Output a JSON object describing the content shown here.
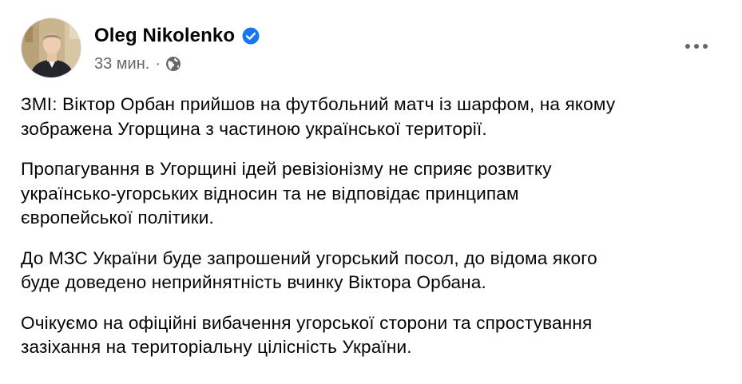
{
  "author": {
    "name": "Oleg Nikolenko",
    "verified": true,
    "timestamp": "33 мин.",
    "separator": "·",
    "audience_icon": "globe-icon"
  },
  "menu_icon": "more-options-icon",
  "colors": {
    "verified_blue": "#1877f2",
    "meta_gray": "#65676b",
    "text": "#050505"
  },
  "post": {
    "paragraphs": [
      {
        "line1": "ЗМІ: Віктор Орбан прийшов на футбольний матч із шарфом, на якому",
        "line2": "зображена Угорщина з частиною української території."
      },
      {
        "line1": "Пропагування в Угорщині ідей ревізіонізму не сприяє розвитку",
        "line2": "українсько-угорських відносин та не відповідає принципам",
        "line3": "європейської політики."
      },
      {
        "line1": "До МЗС України буде запрошений угорський посол, до відома якого",
        "line2": "буде доведено неприйнятність вчинку Віктора Орбана."
      },
      {
        "line1": "Очікуємо на офіційні вибачення угорської сторони та спростування",
        "line2": "зазіхання на територіальну цілісність України."
      }
    ]
  }
}
